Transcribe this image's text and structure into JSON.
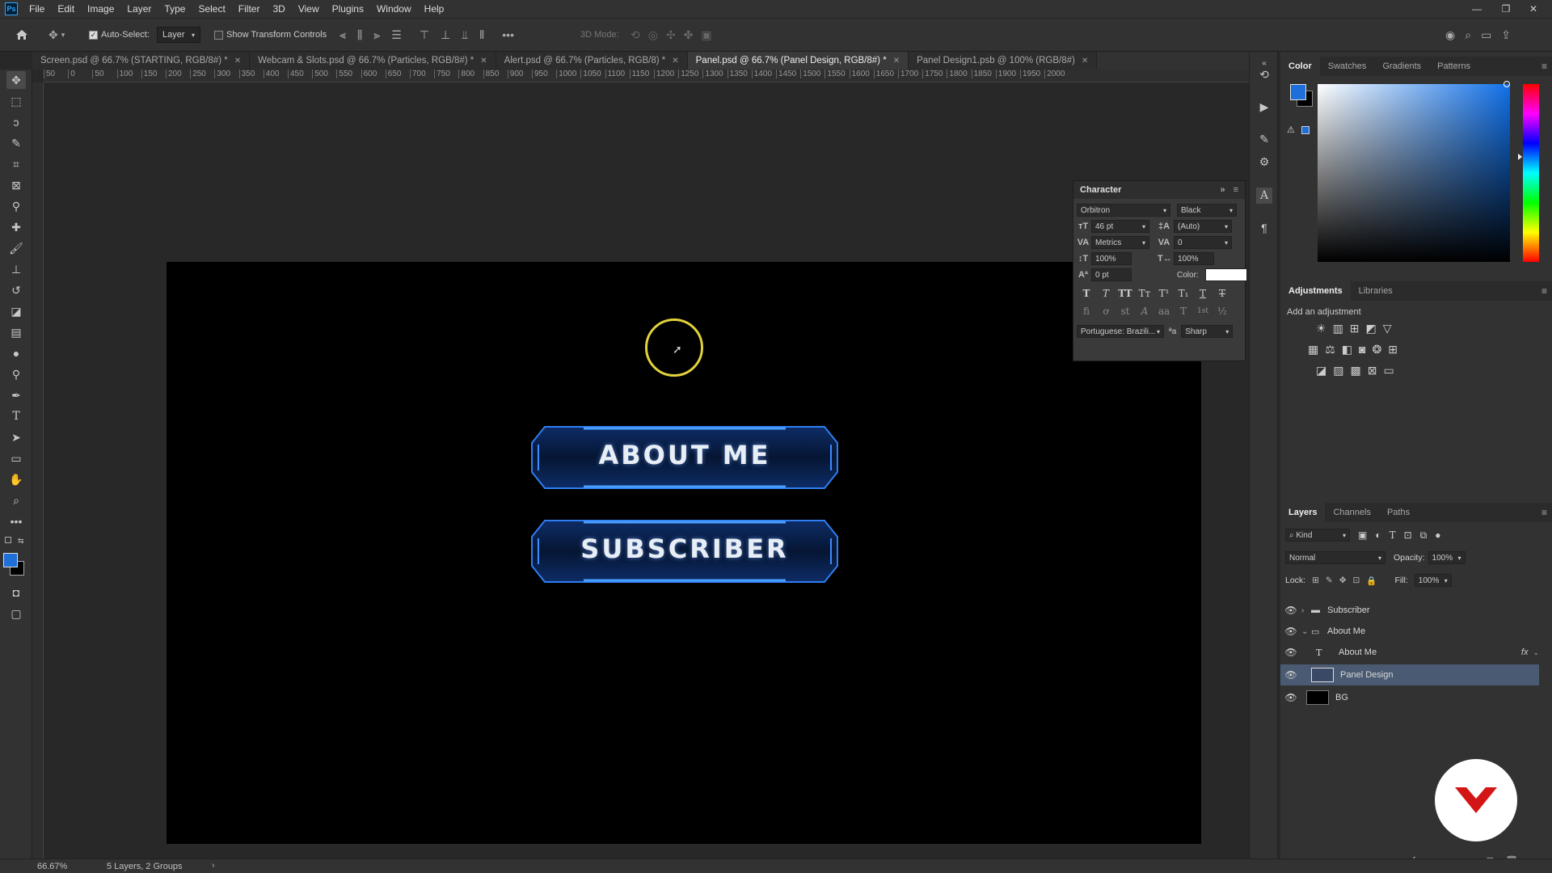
{
  "app": {
    "logo_text": "Ps",
    "menu": [
      "File",
      "Edit",
      "Image",
      "Layer",
      "Type",
      "Select",
      "Filter",
      "3D",
      "View",
      "Plugins",
      "Window",
      "Help"
    ],
    "window_controls": [
      "—",
      "❐",
      "✕"
    ]
  },
  "options": {
    "auto_select_label": "Auto-Select:",
    "auto_select_checked": true,
    "auto_select_target": "Layer",
    "transform_controls_label": "Show Transform Controls",
    "mode_3d_label": "3D Mode:"
  },
  "tabs": [
    {
      "label": "Screen.psd @ 66.7% (STARTING, RGB/8#) *",
      "active": false
    },
    {
      "label": "Webcam & Slots.psd @ 66.7% (Particles, RGB/8#) *",
      "active": false
    },
    {
      "label": "Alert.psd @ 66.7% (Particles, RGB/8) *",
      "active": false
    },
    {
      "label": "Panel.psd @ 66.7% (Panel Design, RGB/8#) *",
      "active": true
    },
    {
      "label": "Panel Design1.psb @ 100% (RGB/8#)",
      "active": false
    }
  ],
  "ruler": {
    "top_ticks": [
      "50",
      "0",
      "50",
      "100",
      "150",
      "200",
      "250",
      "300",
      "350",
      "400",
      "450",
      "500",
      "550",
      "600",
      "650",
      "700",
      "750",
      "800",
      "850",
      "900",
      "950",
      "1000",
      "1050",
      "1100",
      "1150",
      "1200",
      "1250",
      "1300",
      "1350",
      "1400",
      "1450",
      "1500",
      "1550",
      "1600",
      "1650",
      "1700",
      "1750",
      "1800",
      "1850",
      "1900",
      "1950",
      "2000"
    ]
  },
  "canvas": {
    "buttons": [
      {
        "label": "ABOUT ME"
      },
      {
        "label": "SUBSCRIBER"
      }
    ]
  },
  "character_panel": {
    "title": "Character",
    "font_family": "Orbitron",
    "font_style": "Black",
    "font_size": "46 pt",
    "leading": "(Auto)",
    "kerning": "Metrics",
    "tracking": "0",
    "vertical_scale": "100%",
    "horizontal_scale": "100%",
    "baseline_shift": "0 pt",
    "color_label": "Color:",
    "text_color": "#ffffff",
    "style_buttons": [
      "T",
      "T",
      "TT",
      "Tт",
      "T¹",
      "T₁",
      "T",
      "T"
    ],
    "opentype_buttons": [
      "fi",
      "ơ",
      "st",
      "A",
      "aa",
      "T",
      "1st",
      "½"
    ],
    "language": "Portuguese: Brazili...",
    "aa_icon": "ªa",
    "antialias": "Sharp"
  },
  "color_panel": {
    "tabs": [
      "Color",
      "Swatches",
      "Gradients",
      "Patterns"
    ],
    "active_tab": "Color",
    "foreground": "#1f6fd8",
    "background": "#000000"
  },
  "adjustments_panel": {
    "tabs": [
      "Adjustments",
      "Libraries"
    ],
    "active_tab": "Adjustments",
    "hint": "Add an adjustment"
  },
  "layers_panel": {
    "tabs": [
      "Layers",
      "Channels",
      "Paths"
    ],
    "active_tab": "Layers",
    "filter": "Kind",
    "blend_mode": "Normal",
    "opacity_label": "Opacity:",
    "opacity": "100%",
    "lock_label": "Lock:",
    "fill_label": "Fill:",
    "fill": "100%",
    "layers": [
      {
        "name": "Subscriber",
        "type": "group",
        "expanded": false,
        "selected": false
      },
      {
        "name": "About Me",
        "type": "group",
        "expanded": true,
        "selected": false
      },
      {
        "name": "About Me",
        "type": "text",
        "selected": false,
        "fx": "fx"
      },
      {
        "name": "Panel Design",
        "type": "smart",
        "selected": true
      },
      {
        "name": "BG",
        "type": "fill",
        "selected": false
      }
    ]
  },
  "status": {
    "zoom": "66.67%",
    "info": "5 Layers, 2 Groups"
  }
}
